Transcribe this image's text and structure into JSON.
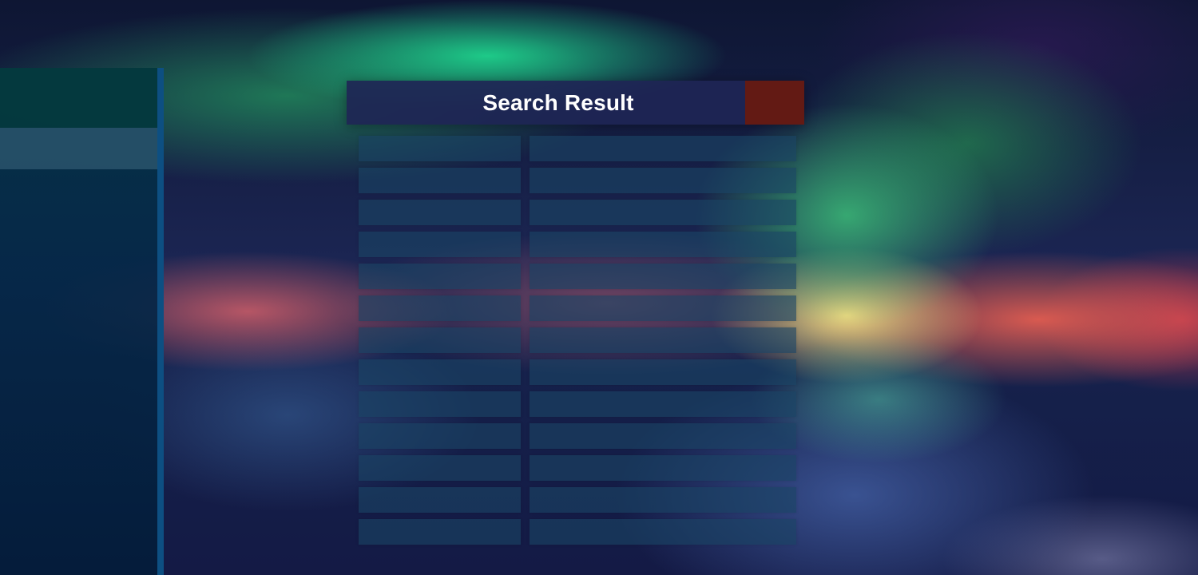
{
  "dialog": {
    "title": "Search Result"
  },
  "colors": {
    "panel_header": "#1e2555",
    "close_button": "#631a14",
    "sidebar": "#05284a",
    "sidebar_selected": "#2a546c",
    "scrollbar": "#0d4f82",
    "result_cell": "#1a4464"
  }
}
